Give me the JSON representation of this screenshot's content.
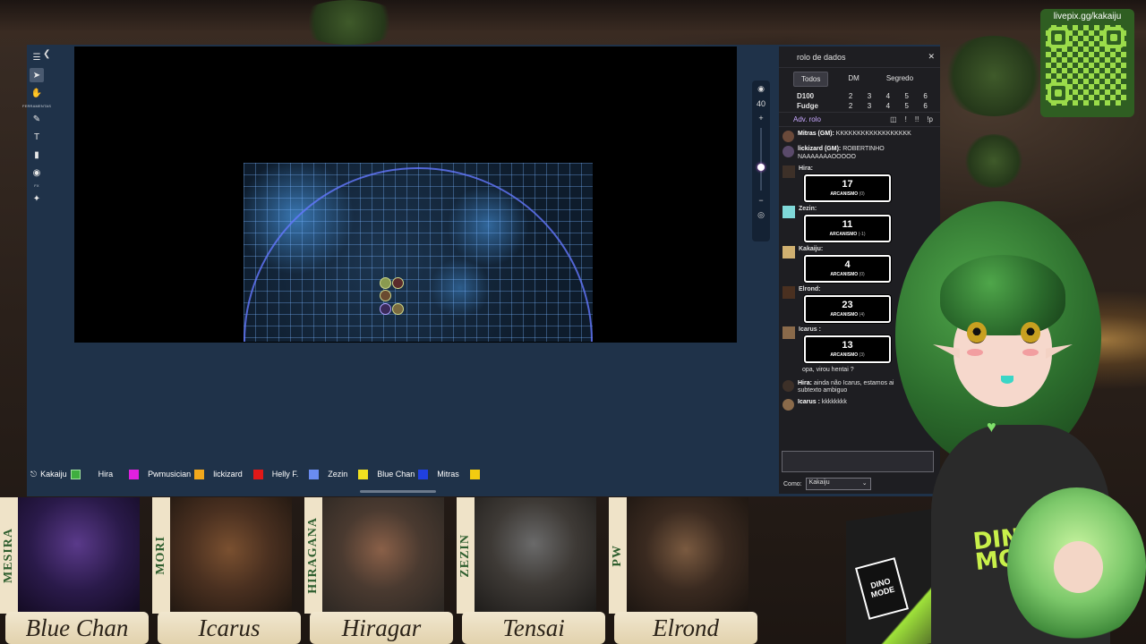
{
  "overlay": {
    "qr_title": "livepix.gg/kakaiju",
    "dino_text": "DINO MODE",
    "dino_badge": "DINO MODE"
  },
  "vtt": {
    "toolbar_label": "FERRAMENTAS",
    "toolbar_fx": "FX",
    "zoom_level": "40",
    "players": [
      {
        "name": "Kakaiju",
        "color": "#3fae3f",
        "icon": "headphones-icon"
      },
      {
        "name": "Hira",
        "color": "#e020e0"
      },
      {
        "name": "Pwmusician",
        "color": "#f2a81c"
      },
      {
        "name": "lickizard",
        "color": "#e01818"
      },
      {
        "name": "Helly F.",
        "color": "#6a8cf0"
      },
      {
        "name": "Zezin",
        "color": "#f0e020"
      },
      {
        "name": "Blue Chan",
        "color": "#2040e0"
      },
      {
        "name": "Mitras",
        "color": "#f2cc10"
      }
    ]
  },
  "chat": {
    "title": "rolo de dados",
    "tabs": [
      "Todos",
      "DM",
      "Segredo"
    ],
    "dice": [
      {
        "name": "D100",
        "values": [
          "2",
          "3",
          "4",
          "5",
          "6"
        ]
      },
      {
        "name": "Fudge",
        "values": [
          "2",
          "3",
          "4",
          "5",
          "6"
        ]
      }
    ],
    "adv_label": "Adv. rolo",
    "adv_actions": [
      "!",
      "!!",
      "!p"
    ],
    "messages": [
      {
        "author": "Mitras (GM):",
        "text": "KKKKKKKKKKKKKKKKKK"
      },
      {
        "author": "lickizard (GM):",
        "text": "ROBERTINHO NAAAAAAAOOOOO"
      }
    ],
    "rolls": [
      {
        "author": "Hira:",
        "value": "17",
        "label": "ARCANISMO",
        "mod": "(0)"
      },
      {
        "author": "Zezin:",
        "value": "11",
        "label": "ARCANISMO",
        "mod": "(-1)"
      },
      {
        "author": "Kakaiju:",
        "value": "4",
        "label": "ARCANISMO",
        "mod": "(0)"
      },
      {
        "author": "Elrond:",
        "value": "23",
        "label": "ARCANISMO",
        "mod": "(4)"
      },
      {
        "author": "Icarus :",
        "value": "13",
        "label": "ARCANISMO",
        "mod": "(3)"
      }
    ],
    "after_text": "opa, virou hentai ?",
    "late_messages": [
      {
        "author": "Hira:",
        "text": "ainda não Icarus, estamos ai subtexto ambiguo"
      },
      {
        "author": "Icarus :",
        "text": "kkkkkkkk"
      }
    ],
    "as_label": "Como:",
    "as_value": "Kakaiju"
  },
  "cards": [
    {
      "banner": "MESIRA",
      "name": "Blue Chan"
    },
    {
      "banner": "MORI",
      "name": "Icarus"
    },
    {
      "banner": "HIRAGANA",
      "name": "Hiragar"
    },
    {
      "banner": "ZEZIN",
      "name": "Tensai"
    },
    {
      "banner": "PW",
      "name": "Elrond"
    }
  ]
}
